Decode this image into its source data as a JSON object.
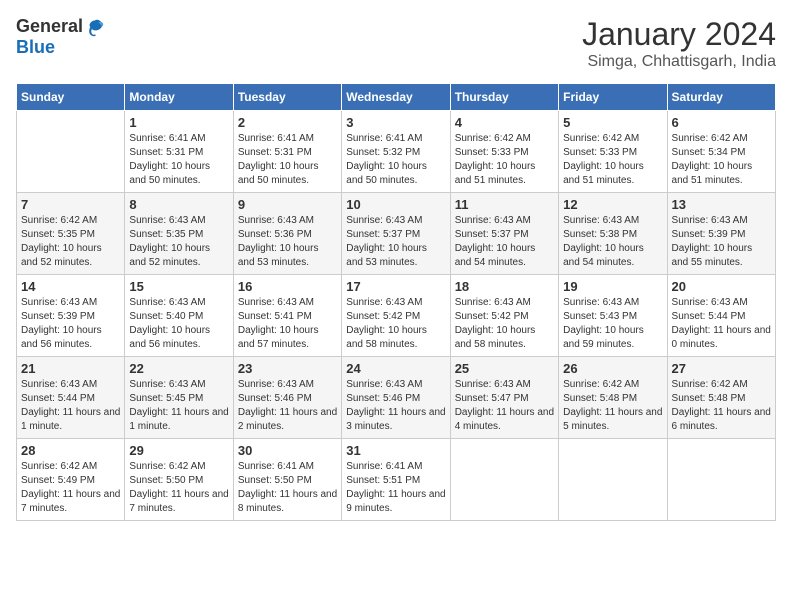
{
  "header": {
    "logo_general": "General",
    "logo_blue": "Blue",
    "month_year": "January 2024",
    "location": "Simga, Chhattisgarh, India"
  },
  "days_of_week": [
    "Sunday",
    "Monday",
    "Tuesday",
    "Wednesday",
    "Thursday",
    "Friday",
    "Saturday"
  ],
  "weeks": [
    [
      {
        "day": "",
        "sunrise": "",
        "sunset": "",
        "daylight": ""
      },
      {
        "day": "1",
        "sunrise": "6:41 AM",
        "sunset": "5:31 PM",
        "daylight": "10 hours and 50 minutes."
      },
      {
        "day": "2",
        "sunrise": "6:41 AM",
        "sunset": "5:31 PM",
        "daylight": "10 hours and 50 minutes."
      },
      {
        "day": "3",
        "sunrise": "6:41 AM",
        "sunset": "5:32 PM",
        "daylight": "10 hours and 50 minutes."
      },
      {
        "day": "4",
        "sunrise": "6:42 AM",
        "sunset": "5:33 PM",
        "daylight": "10 hours and 51 minutes."
      },
      {
        "day": "5",
        "sunrise": "6:42 AM",
        "sunset": "5:33 PM",
        "daylight": "10 hours and 51 minutes."
      },
      {
        "day": "6",
        "sunrise": "6:42 AM",
        "sunset": "5:34 PM",
        "daylight": "10 hours and 51 minutes."
      }
    ],
    [
      {
        "day": "7",
        "sunrise": "6:42 AM",
        "sunset": "5:35 PM",
        "daylight": "10 hours and 52 minutes."
      },
      {
        "day": "8",
        "sunrise": "6:43 AM",
        "sunset": "5:35 PM",
        "daylight": "10 hours and 52 minutes."
      },
      {
        "day": "9",
        "sunrise": "6:43 AM",
        "sunset": "5:36 PM",
        "daylight": "10 hours and 53 minutes."
      },
      {
        "day": "10",
        "sunrise": "6:43 AM",
        "sunset": "5:37 PM",
        "daylight": "10 hours and 53 minutes."
      },
      {
        "day": "11",
        "sunrise": "6:43 AM",
        "sunset": "5:37 PM",
        "daylight": "10 hours and 54 minutes."
      },
      {
        "day": "12",
        "sunrise": "6:43 AM",
        "sunset": "5:38 PM",
        "daylight": "10 hours and 54 minutes."
      },
      {
        "day": "13",
        "sunrise": "6:43 AM",
        "sunset": "5:39 PM",
        "daylight": "10 hours and 55 minutes."
      }
    ],
    [
      {
        "day": "14",
        "sunrise": "6:43 AM",
        "sunset": "5:39 PM",
        "daylight": "10 hours and 56 minutes."
      },
      {
        "day": "15",
        "sunrise": "6:43 AM",
        "sunset": "5:40 PM",
        "daylight": "10 hours and 56 minutes."
      },
      {
        "day": "16",
        "sunrise": "6:43 AM",
        "sunset": "5:41 PM",
        "daylight": "10 hours and 57 minutes."
      },
      {
        "day": "17",
        "sunrise": "6:43 AM",
        "sunset": "5:42 PM",
        "daylight": "10 hours and 58 minutes."
      },
      {
        "day": "18",
        "sunrise": "6:43 AM",
        "sunset": "5:42 PM",
        "daylight": "10 hours and 58 minutes."
      },
      {
        "day": "19",
        "sunrise": "6:43 AM",
        "sunset": "5:43 PM",
        "daylight": "10 hours and 59 minutes."
      },
      {
        "day": "20",
        "sunrise": "6:43 AM",
        "sunset": "5:44 PM",
        "daylight": "11 hours and 0 minutes."
      }
    ],
    [
      {
        "day": "21",
        "sunrise": "6:43 AM",
        "sunset": "5:44 PM",
        "daylight": "11 hours and 1 minute."
      },
      {
        "day": "22",
        "sunrise": "6:43 AM",
        "sunset": "5:45 PM",
        "daylight": "11 hours and 1 minute."
      },
      {
        "day": "23",
        "sunrise": "6:43 AM",
        "sunset": "5:46 PM",
        "daylight": "11 hours and 2 minutes."
      },
      {
        "day": "24",
        "sunrise": "6:43 AM",
        "sunset": "5:46 PM",
        "daylight": "11 hours and 3 minutes."
      },
      {
        "day": "25",
        "sunrise": "6:43 AM",
        "sunset": "5:47 PM",
        "daylight": "11 hours and 4 minutes."
      },
      {
        "day": "26",
        "sunrise": "6:42 AM",
        "sunset": "5:48 PM",
        "daylight": "11 hours and 5 minutes."
      },
      {
        "day": "27",
        "sunrise": "6:42 AM",
        "sunset": "5:48 PM",
        "daylight": "11 hours and 6 minutes."
      }
    ],
    [
      {
        "day": "28",
        "sunrise": "6:42 AM",
        "sunset": "5:49 PM",
        "daylight": "11 hours and 7 minutes."
      },
      {
        "day": "29",
        "sunrise": "6:42 AM",
        "sunset": "5:50 PM",
        "daylight": "11 hours and 7 minutes."
      },
      {
        "day": "30",
        "sunrise": "6:41 AM",
        "sunset": "5:50 PM",
        "daylight": "11 hours and 8 minutes."
      },
      {
        "day": "31",
        "sunrise": "6:41 AM",
        "sunset": "5:51 PM",
        "daylight": "11 hours and 9 minutes."
      },
      {
        "day": "",
        "sunrise": "",
        "sunset": "",
        "daylight": ""
      },
      {
        "day": "",
        "sunrise": "",
        "sunset": "",
        "daylight": ""
      },
      {
        "day": "",
        "sunrise": "",
        "sunset": "",
        "daylight": ""
      }
    ]
  ]
}
